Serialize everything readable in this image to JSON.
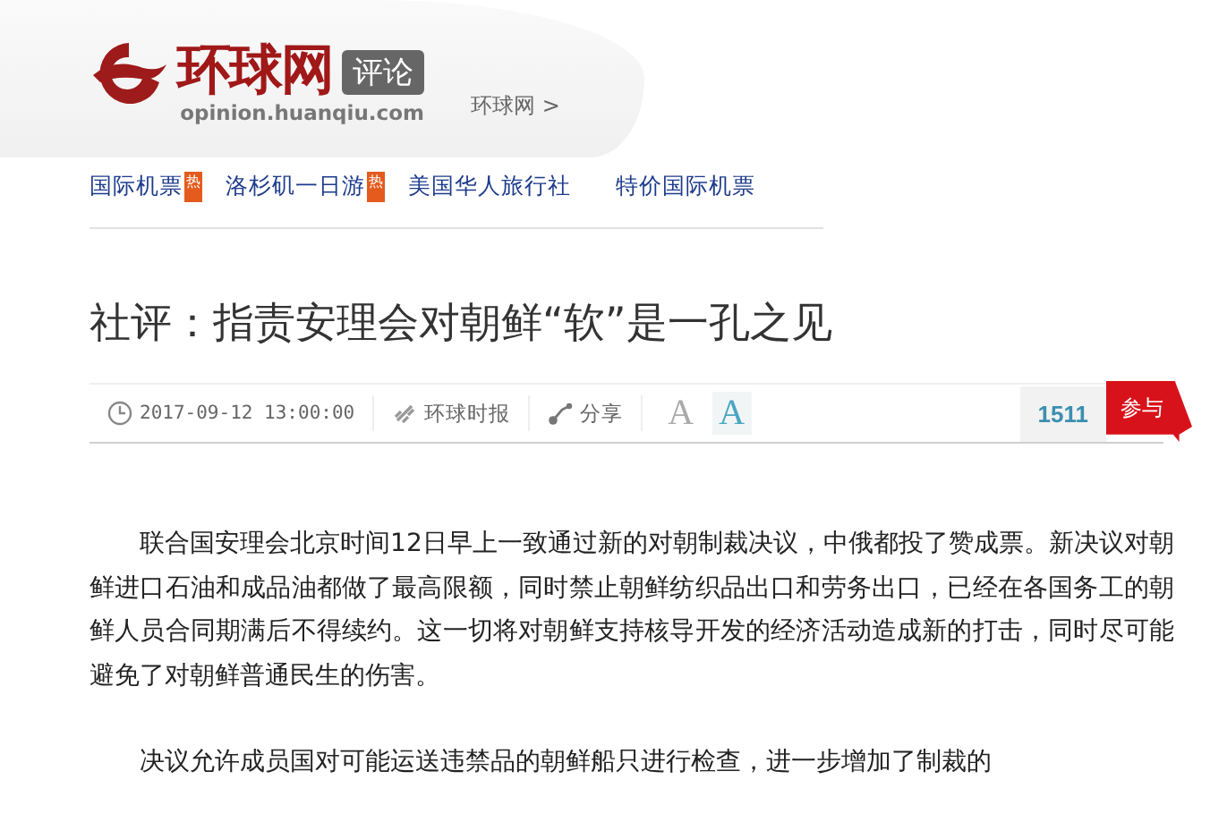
{
  "header": {
    "logo_text": "环球网",
    "section_badge": "评论",
    "domain": "opinion.huanqiu.com",
    "breadcrumb": "环球网 >"
  },
  "nav": [
    {
      "label": "国际机票",
      "hot": true,
      "hot_label": "热"
    },
    {
      "label": "洛杉矶一日游",
      "hot": true,
      "hot_label": "热"
    },
    {
      "label": "美国华人旅行社",
      "hot": false
    },
    {
      "label": "特价国际机票",
      "hot": false
    }
  ],
  "title": "社评：指责安理会对朝鲜“软”是一孔之见",
  "toolbar": {
    "time": "2017-09-12 13:00:00",
    "source": "环球时报",
    "share": "分享",
    "font_smaller": "A",
    "font_larger": "A",
    "comment_count": "1511",
    "join": "参与"
  },
  "paragraphs": [
    "联合国安理会北京时间12日早上一致通过新的对朝制裁决议，中俄都投了赞成票。新决议对朝鲜进口石油和成品油都做了最高限额，同时禁止朝鲜纺织品出口和劳务出口，已经在各国务工的朝鲜人员合同期满后不得续约。这一切将对朝鲜支持核导开发的经济活动造成新的打击，同时尽可能避免了对朝鲜普通民生的伤害。",
    "决议允许成员国对可能运送违禁品的朝鲜船只进行检查，进一步增加了制裁的"
  ]
}
